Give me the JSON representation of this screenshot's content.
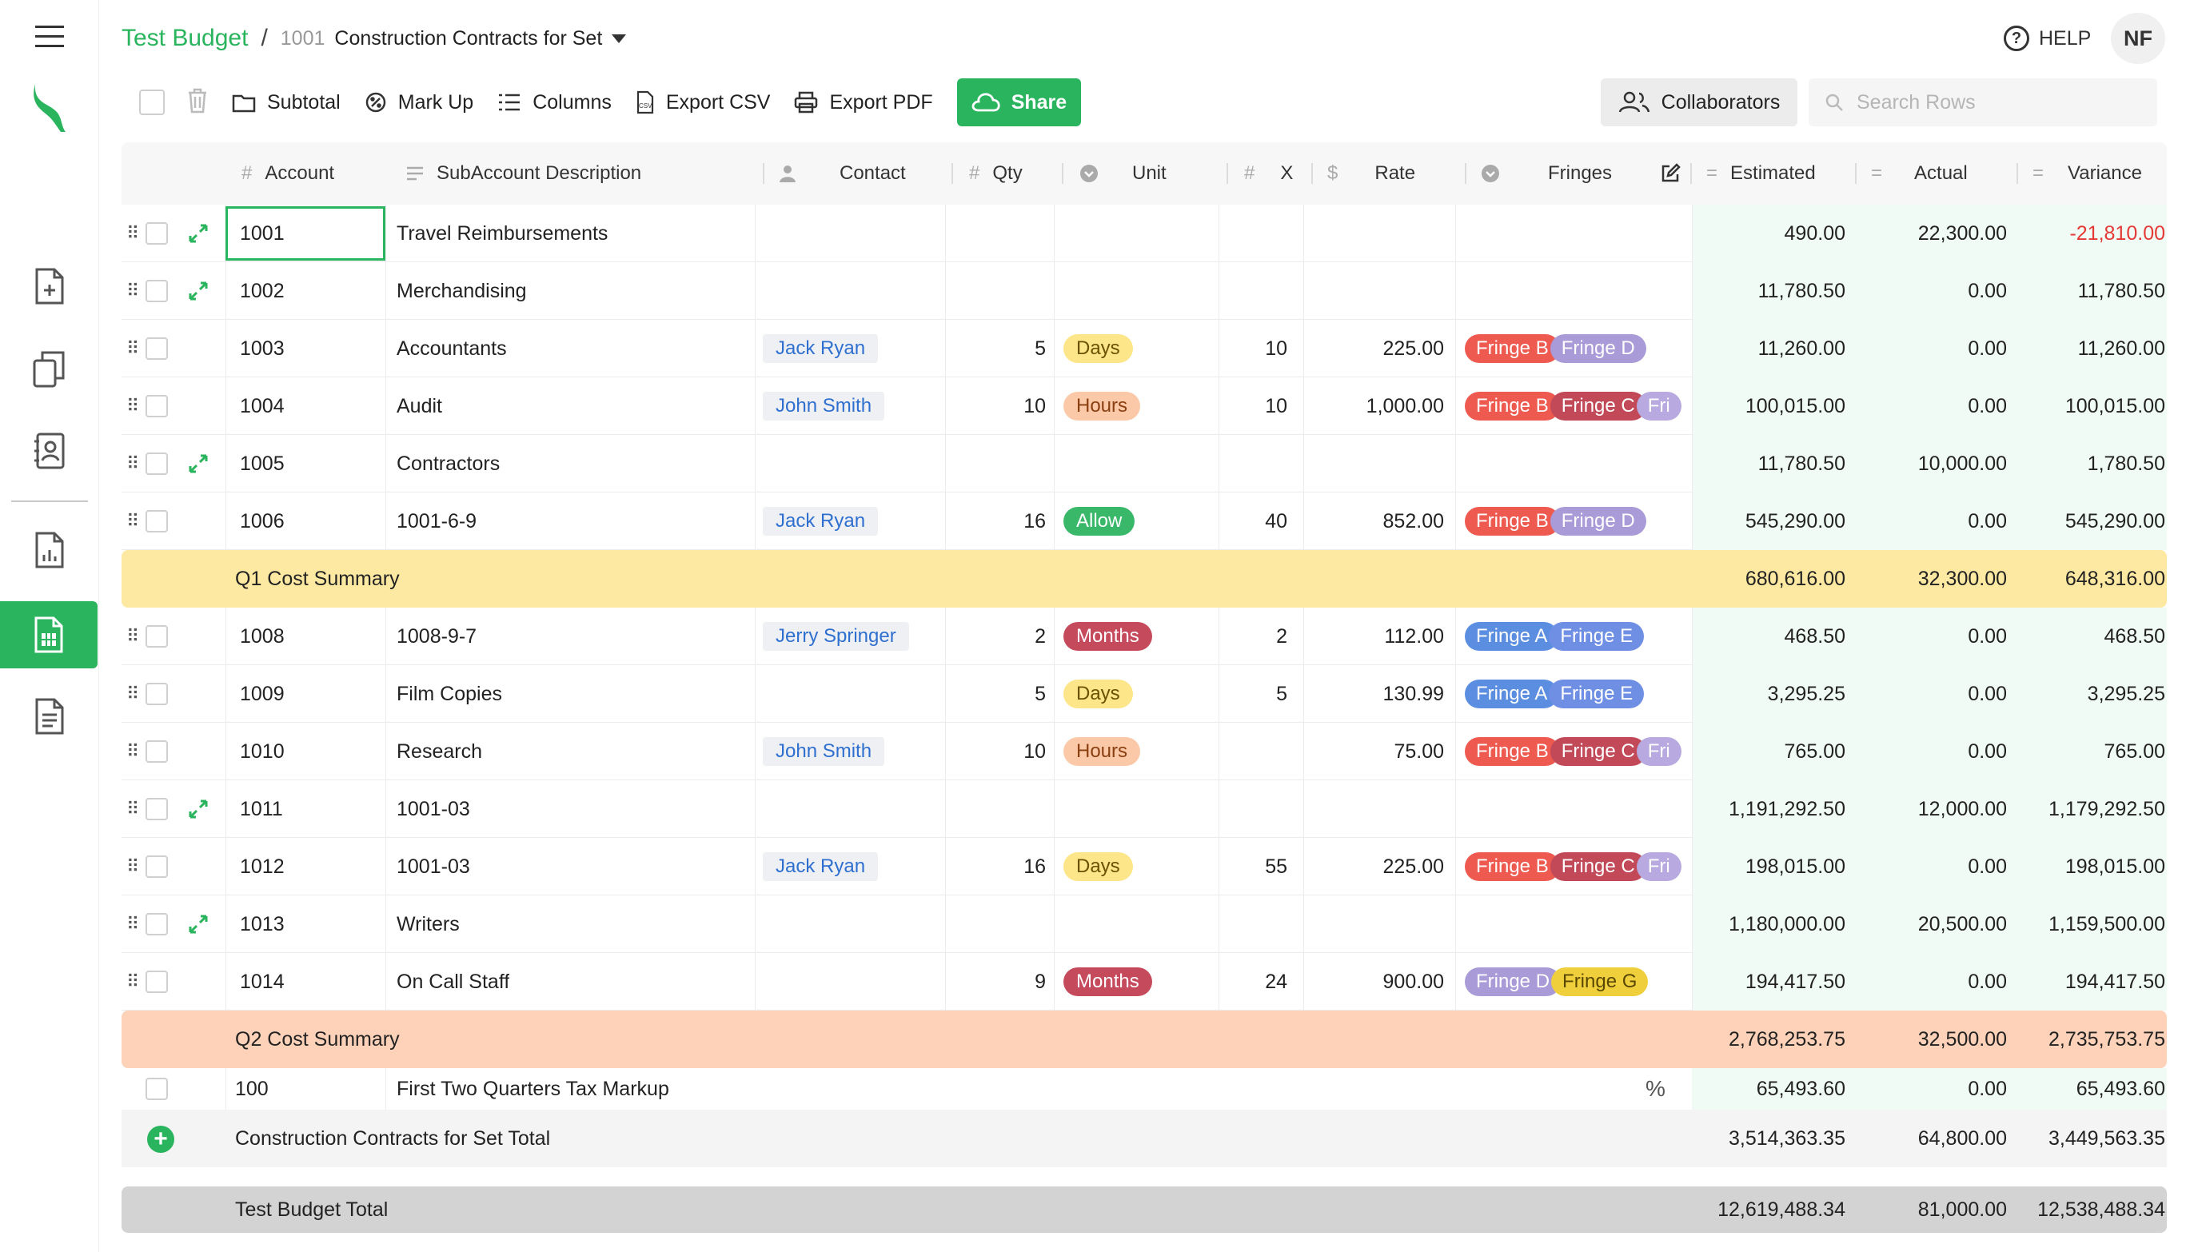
{
  "breadcrumb": {
    "budget": "Test Budget",
    "separator": "/",
    "account_number": "1001",
    "account_name": "Construction Contracts for Set"
  },
  "header": {
    "help_label": "HELP",
    "avatar_initials": "NF"
  },
  "toolbar": {
    "subtotal": "Subtotal",
    "markup": "Mark Up",
    "columns": "Columns",
    "export_csv": "Export CSV",
    "export_pdf": "Export PDF",
    "share": "Share",
    "collaborators": "Collaborators",
    "search_placeholder": "Search Rows"
  },
  "colors": {
    "brand": "#2ab45e",
    "negative": "#e53935",
    "q1_group": "#fde9a2",
    "q2_group": "#fdd2b8"
  },
  "columns": {
    "account": "Account",
    "description": "SubAccount Description",
    "contact": "Contact",
    "qty": "Qty",
    "unit": "Unit",
    "x": "X",
    "rate": "Rate",
    "fringes": "Fringes",
    "estimated": "Estimated",
    "actual": "Actual",
    "variance": "Variance"
  },
  "rows": [
    {
      "account": "1001",
      "description": "Travel Reimbursements",
      "contact": "",
      "qty": "",
      "unit": "",
      "x": "",
      "rate": "",
      "fringes": [],
      "estimated": "490.00",
      "actual": "22,300.00",
      "variance": "-21,810.00",
      "expand": true
    },
    {
      "account": "1002",
      "description": "Merchandising",
      "contact": "",
      "qty": "",
      "unit": "",
      "x": "",
      "rate": "",
      "fringes": [],
      "estimated": "11,780.50",
      "actual": "0.00",
      "variance": "11,780.50",
      "expand": true
    },
    {
      "account": "1003",
      "description": "Accountants",
      "contact": "Jack Ryan",
      "qty": "5",
      "unit": "Days",
      "x": "10",
      "rate": "225.00",
      "fringes": [
        "Fringe B",
        "Fringe D"
      ],
      "estimated": "11,260.00",
      "actual": "0.00",
      "variance": "11,260.00",
      "expand": false
    },
    {
      "account": "1004",
      "description": "Audit",
      "contact": "John Smith",
      "qty": "10",
      "unit": "Hours",
      "x": "10",
      "rate": "1,000.00",
      "fringes": [
        "Fringe B",
        "Fringe C",
        "Fri"
      ],
      "estimated": "100,015.00",
      "actual": "0.00",
      "variance": "100,015.00",
      "expand": false
    },
    {
      "account": "1005",
      "description": "Contractors",
      "contact": "",
      "qty": "",
      "unit": "",
      "x": "",
      "rate": "",
      "fringes": [],
      "estimated": "11,780.50",
      "actual": "10,000.00",
      "variance": "1,780.50",
      "expand": true
    },
    {
      "account": "1006",
      "description": "1001-6-9",
      "contact": "Jack Ryan",
      "qty": "16",
      "unit": "Allow",
      "x": "40",
      "rate": "852.00",
      "fringes": [
        "Fringe B",
        "Fringe D"
      ],
      "estimated": "545,290.00",
      "actual": "0.00",
      "variance": "545,290.00",
      "expand": false
    }
  ],
  "group_q1": {
    "label": "Q1 Cost Summary",
    "estimated": "680,616.00",
    "actual": "32,300.00",
    "variance": "648,316.00"
  },
  "rows2": [
    {
      "account": "1008",
      "description": "1008-9-7",
      "contact": "Jerry Springer",
      "qty": "2",
      "unit": "Months",
      "x": "2",
      "rate": "112.00",
      "fringes": [
        "Fringe A",
        "Fringe E"
      ],
      "estimated": "468.50",
      "actual": "0.00",
      "variance": "468.50",
      "expand": false
    },
    {
      "account": "1009",
      "description": "Film Copies",
      "contact": "",
      "qty": "5",
      "unit": "Days",
      "x": "5",
      "rate": "130.99",
      "fringes": [
        "Fringe A",
        "Fringe E"
      ],
      "estimated": "3,295.25",
      "actual": "0.00",
      "variance": "3,295.25",
      "expand": false
    },
    {
      "account": "1010",
      "description": "Research",
      "contact": "John Smith",
      "qty": "10",
      "unit": "Hours",
      "x": "",
      "rate": "75.00",
      "fringes": [
        "Fringe B",
        "Fringe C",
        "Fri"
      ],
      "estimated": "765.00",
      "actual": "0.00",
      "variance": "765.00",
      "expand": false
    },
    {
      "account": "1011",
      "description": "1001-03",
      "contact": "",
      "qty": "",
      "unit": "",
      "x": "",
      "rate": "",
      "fringes": [],
      "estimated": "1,191,292.50",
      "actual": "12,000.00",
      "variance": "1,179,292.50",
      "expand": true
    },
    {
      "account": "1012",
      "description": "1001-03",
      "contact": "Jack Ryan",
      "qty": "16",
      "unit": "Days",
      "x": "55",
      "rate": "225.00",
      "fringes": [
        "Fringe B",
        "Fringe C",
        "Fri"
      ],
      "estimated": "198,015.00",
      "actual": "0.00",
      "variance": "198,015.00",
      "expand": false
    },
    {
      "account": "1013",
      "description": "Writers",
      "contact": "",
      "qty": "",
      "unit": "",
      "x": "",
      "rate": "",
      "fringes": [],
      "estimated": "1,180,000.00",
      "actual": "20,500.00",
      "variance": "1,159,500.00",
      "expand": true
    },
    {
      "account": "1014",
      "description": "On Call Staff",
      "contact": "",
      "qty": "9",
      "unit": "Months",
      "x": "24",
      "rate": "900.00",
      "fringes": [
        "Fringe D",
        "Fringe G"
      ],
      "estimated": "194,417.50",
      "actual": "0.00",
      "variance": "194,417.50",
      "expand": false
    }
  ],
  "group_q2": {
    "label": "Q2 Cost Summary",
    "estimated": "2,768,253.75",
    "actual": "32,500.00",
    "variance": "2,735,753.75"
  },
  "markup_row": {
    "account": "100",
    "description": "First Two Quarters Tax Markup",
    "unit_icon": "%",
    "estimated": "65,493.60",
    "actual": "0.00",
    "variance": "65,493.60"
  },
  "account_total": {
    "label": "Construction Contracts for Set Total",
    "estimated": "3,514,363.35",
    "actual": "64,800.00",
    "variance": "3,449,563.35"
  },
  "budget_total": {
    "label": "Test Budget Total",
    "estimated": "12,619,488.34",
    "actual": "81,000.00",
    "variance": "12,538,488.34"
  }
}
